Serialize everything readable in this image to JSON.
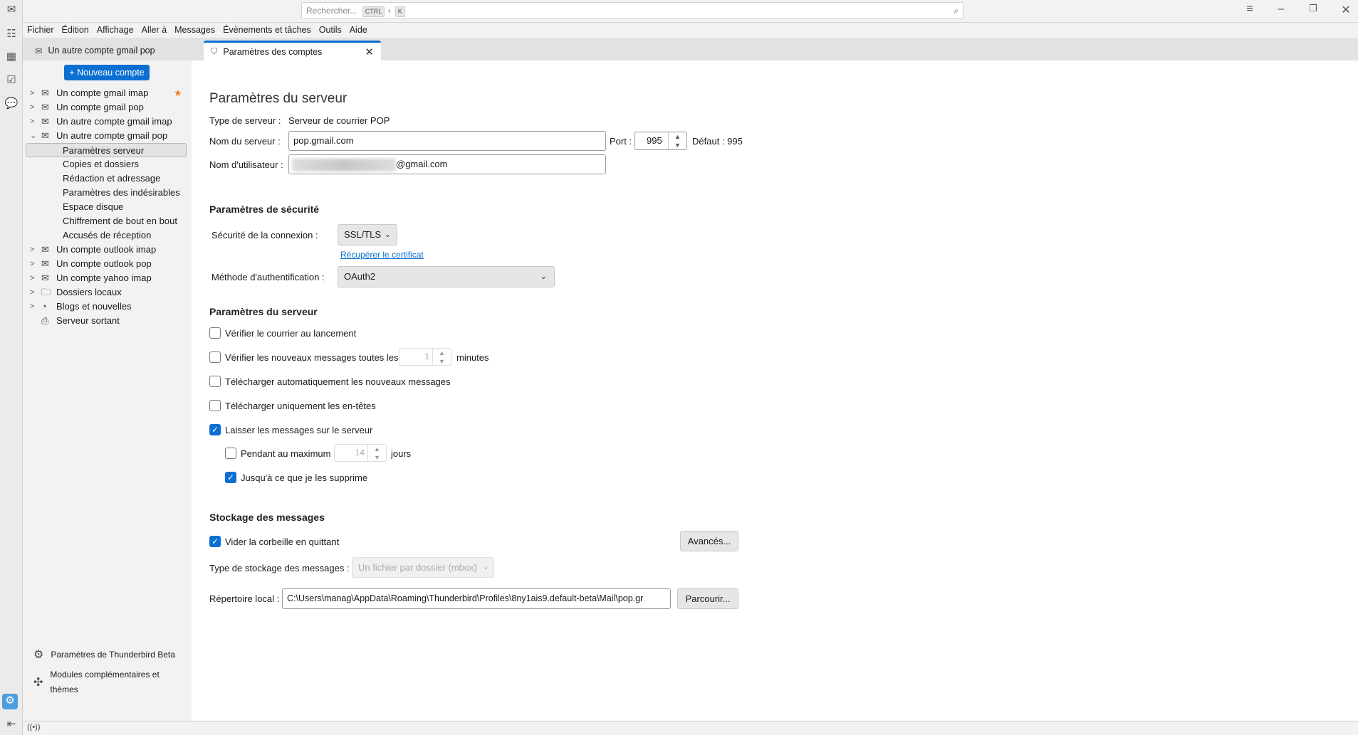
{
  "search": {
    "placeholder": "Rechercher...",
    "key1": "CTRL",
    "plus": "+",
    "key2": "K"
  },
  "menu": [
    "Fichier",
    "Édition",
    "Affichage",
    "Aller à",
    "Messages",
    "Évènements et tâches",
    "Outils",
    "Aide"
  ],
  "tabs": [
    {
      "label": "Un autre compte gmail pop"
    },
    {
      "label": "Paramètres des comptes"
    }
  ],
  "sidebar": {
    "new_account": "Nouveau compte",
    "accounts": [
      {
        "label": "Un compte gmail imap"
      },
      {
        "label": "Un compte gmail pop"
      },
      {
        "label": "Un autre compte gmail imap"
      },
      {
        "label": "Un autre compte gmail pop"
      }
    ],
    "subitems": [
      "Paramètres serveur",
      "Copies et dossiers",
      "Rédaction et adressage",
      "Paramètres des indésirables",
      "Espace disque",
      "Chiffrement de bout en bout",
      "Accusés de réception"
    ],
    "more": [
      "Un compte outlook imap",
      "Un compte outlook pop",
      "Un compte yahoo imap",
      "Dossiers locaux",
      "Blogs et nouvelles",
      "Serveur sortant"
    ],
    "settings": "Paramètres de Thunderbird Beta",
    "addons_l1": "Modules complémentaires et",
    "addons_l2": "thèmes"
  },
  "main": {
    "title": "Paramètres du serveur",
    "server_type_label": "Type de serveur :",
    "server_type": "Serveur de courrier POP",
    "server_name_label": "Nom du serveur :",
    "server_name": "pop.gmail.com",
    "port_label": "Port :",
    "port": "995",
    "default_port": "Défaut : 995",
    "username_label": "Nom d'utilisateur :",
    "username_suffix": "@gmail.com",
    "security_heading": "Paramètres de sécurité",
    "conn_security_label": "Sécurité de la connexion :",
    "conn_security": "SSL/TLS",
    "get_cert": "Récupérer le certificat",
    "auth_label": "Méthode d'authentification :",
    "auth": "OAuth2",
    "server_heading": "Paramètres du serveur",
    "check_startup": "Vérifier le courrier au lancement",
    "check_every": "Vérifier les nouveaux messages toutes les",
    "check_every_value": "1",
    "minutes": "minutes",
    "auto_download": "Télécharger automatiquement les nouveaux messages",
    "headers_only": "Télécharger uniquement les en-têtes",
    "leave_on_server": "Laisser les messages sur le serveur",
    "max_days": "Pendant au maximum",
    "max_days_value": "14",
    "days": "jours",
    "until_delete": "Jusqu'à ce que je les supprime",
    "storage_heading": "Stockage des messages",
    "empty_trash": "Vider la corbeille en quittant",
    "advanced": "Avancés...",
    "storage_type_label": "Type de stockage des messages :",
    "storage_type": "Un fichier par dossier (mbox)",
    "local_dir_label": "Répertoire local :",
    "local_dir": "C:\\Users\\manag\\AppData\\Roaming\\Thunderbird\\Profiles\\8ny1ais9.default-beta\\Mail\\pop.gr",
    "browse": "Parcourir..."
  },
  "checkbox_states": {
    "check_startup": false,
    "check_every": false,
    "auto_download": false,
    "headers_only": false,
    "leave_on_server": true,
    "max_days": false,
    "until_delete": true,
    "empty_trash": true
  },
  "colors": {
    "accent": "#0a6fd1"
  }
}
